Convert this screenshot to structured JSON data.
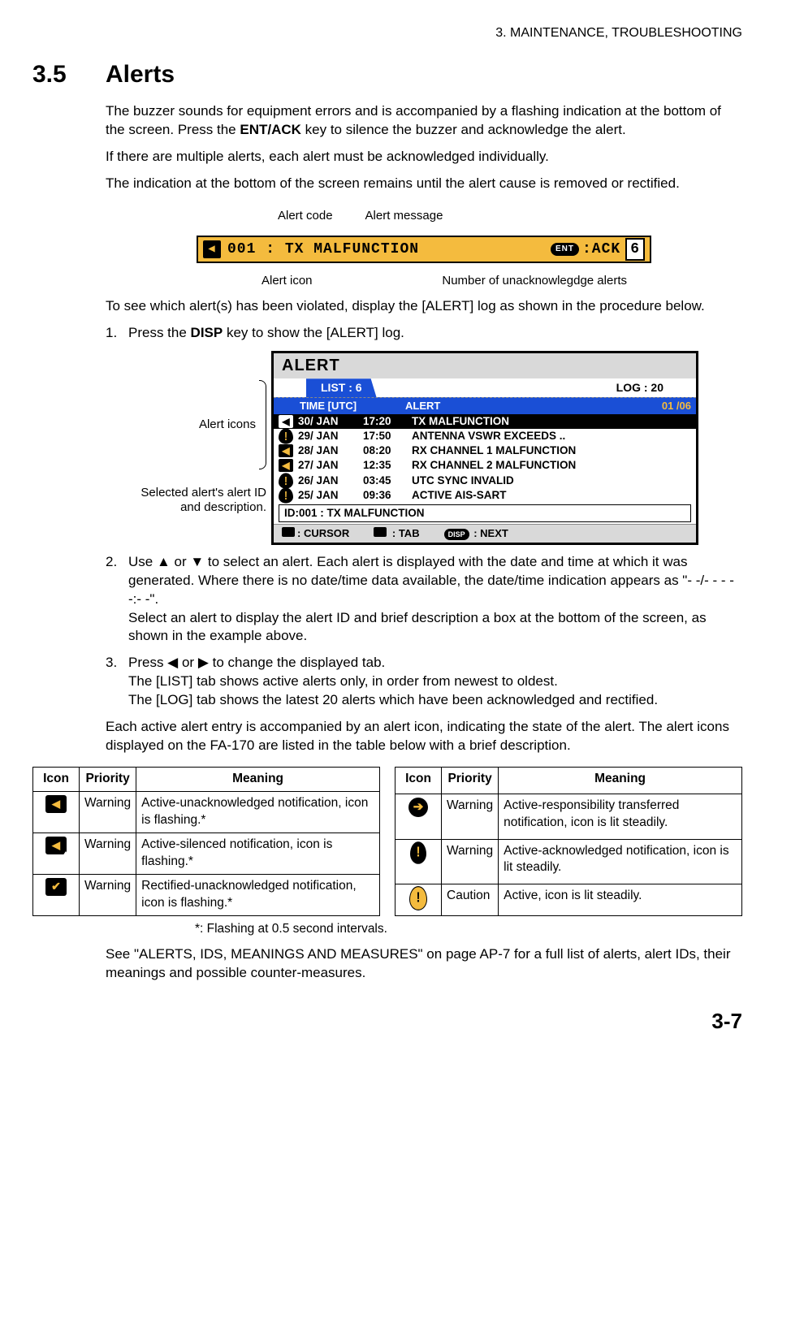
{
  "header": {
    "chapter": "3.  MAINTENANCE, TROUBLESHOOTING"
  },
  "section": {
    "number": "3.5",
    "title": "Alerts"
  },
  "p1a": "The buzzer sounds for equipment errors and is accompanied by a flashing indication at the bottom of the screen. Press the ",
  "p1b": "ENT/ACK",
  "p1c": " key to silence the buzzer and acknowledge the alert.",
  "p2": "If there are multiple alerts, each alert must be acknowledged individually.",
  "p3": "The indication at the bottom of the screen remains until the alert cause is removed or rectified.",
  "fig1": {
    "call_code": "Alert code",
    "call_msg": "Alert message",
    "call_icon": "Alert icon",
    "call_count": "Number of unacknowlegdge alerts",
    "banner_code": "001",
    "banner_sep": ":",
    "banner_msg": "TX MALFUNCTION",
    "banner_ent": "ENT",
    "banner_ack": ":ACK",
    "banner_count": "6"
  },
  "p4": "To see which alert(s) has been violated, display the [ALERT] log as shown in the procedure below.",
  "step1a": "Press the ",
  "step1b": "DISP",
  "step1c": " key to show the [ALERT] log.",
  "fig2labels": {
    "icons": "Alert icons",
    "detail": "Selected  alert's alert ID and description."
  },
  "screen": {
    "title": "ALERT",
    "tab_active": "LIST : 6",
    "tab_other": "LOG : 20",
    "col_time": "TIME [UTC]",
    "col_alert": "ALERT",
    "page": "01 /06",
    "rows": [
      {
        "icon": "speaker",
        "date": "30/ JAN",
        "time": "17:20",
        "msg": "TX MALFUNCTION",
        "sel": true
      },
      {
        "icon": "exc",
        "date": "29/ JAN",
        "time": "17:50",
        "msg": "ANTENNA VSWR EXCEEDS .."
      },
      {
        "icon": "speaker",
        "date": "28/ JAN",
        "time": "08:20",
        "msg": "RX CHANNEL 1 MALFUNCTION"
      },
      {
        "icon": "speaker",
        "date": "27/ JAN",
        "time": "12:35",
        "msg": "RX CHANNEL 2 MALFUNCTION"
      },
      {
        "icon": "exc",
        "date": "26/ JAN",
        "time": "03:45",
        "msg": "UTC SYNC INVALID"
      },
      {
        "icon": "exc",
        "date": "25/ JAN",
        "time": "09:36",
        "msg": "ACTIVE AIS-SART"
      }
    ],
    "detail": "ID:001    :   TX MALFUNCTION",
    "foot_cursor": ": CURSOR",
    "foot_tab": " : TAB",
    "foot_next": " : NEXT",
    "foot_disp": "DISP"
  },
  "step2": "Use ▲ or ▼ to select an alert. Each alert is displayed with the date and time at which it was generated. Where there is no date/time data available, the date/time indication appears as \"- -/- - -  - -:- -\".\nSelect an alert to display the alert ID and brief description a box at the bottom of the screen, as shown in the example above.",
  "step3": "Press ◀ or ▶ to change the displayed tab.\nThe [LIST] tab shows active alerts only, in order from newest to oldest.\nThe [LOG] tab shows the latest 20 alerts which have been acknowledged and rectified.",
  "p5": "Each active alert entry is accompanied by an alert icon, indicating the state of the alert. The alert icons displayed on the FA-170 are listed in the table below with a brief description.",
  "th": {
    "icon": "Icon",
    "priority": "Priority",
    "meaning": "Meaning"
  },
  "tableL": [
    {
      "priority": "Warning",
      "meaning": "Active-unacknowledged notification, icon is flashing.*"
    },
    {
      "priority": "Warning",
      "meaning": "Active-silenced notification, icon is flashing.*"
    },
    {
      "priority": "Warning",
      "meaning": "Rectified-unacknowledged notification, icon is flashing.*"
    }
  ],
  "tableR": [
    {
      "priority": "Warning",
      "meaning": "Active-responsibility transferred notification, icon is lit steadily."
    },
    {
      "priority": "Warning",
      "meaning": "Active-acknowledged notification, icon is lit steadily."
    },
    {
      "priority": "Caution",
      "meaning": "Active, icon is lit steadily."
    }
  ],
  "footnote": "*: Flashing at 0.5 second intervals.",
  "p6": "See \"ALERTS, IDS, MEANINGS AND MEASURES\" on page AP-7 for a full list of alerts, alert IDs, their meanings and possible counter-measures.",
  "pagenum": "3-7"
}
